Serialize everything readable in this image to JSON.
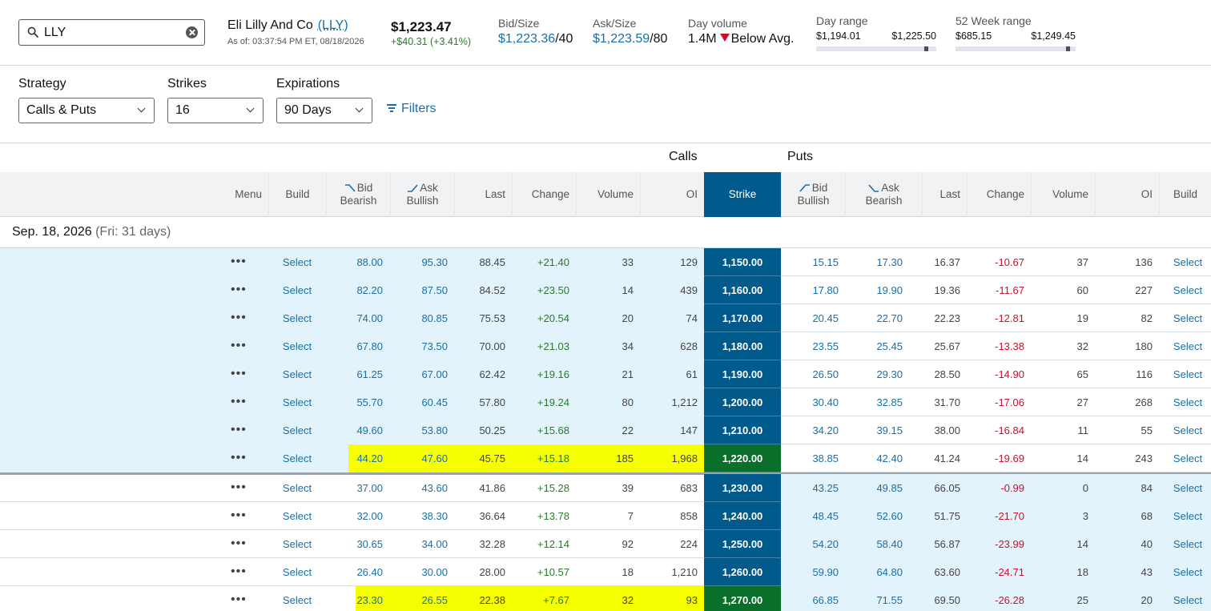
{
  "quote": {
    "search_value": "LLY",
    "company_name": "Eli Lilly And Co",
    "symbol": "(LLY)",
    "as_of": "As of: 03:37:54 PM ET, 08/18/2026",
    "last_price": "$1,223.47",
    "net_change": "+$40.31 (+3.41%)",
    "bid_size_label": "Bid/Size",
    "bid_price": "$1,223.36",
    "bid_size": "/40",
    "ask_size_label": "Ask/Size",
    "ask_price": "$1,223.59",
    "ask_size": "/80",
    "day_volume_label": "Day volume",
    "day_volume": "1.4M",
    "day_volume_note": "Below Avg.",
    "day_range_label": "Day range",
    "day_range_low": "$1,194.01",
    "day_range_high": "$1,225.50",
    "day_range_position": 0.93,
    "week52_label": "52 Week range",
    "week52_low": "$685.15",
    "week52_high": "$1,249.45",
    "week52_position": 0.95
  },
  "controls": {
    "strategy_label": "Strategy",
    "strategy_value": "Calls & Puts",
    "strikes_label": "Strikes",
    "strikes_value": "16",
    "expirations_label": "Expirations",
    "expirations_value": "90 Days",
    "filters_label": "Filters"
  },
  "chain": {
    "calls_label": "Calls",
    "puts_label": "Puts",
    "headers": {
      "menu": "Menu",
      "build": "Build",
      "bid_top": "Bid",
      "bid_bottom": "Bearish",
      "ask_top": "Ask",
      "ask_bottom": "Bullish",
      "last": "Last",
      "change": "Change",
      "volume": "Volume",
      "oi": "OI",
      "strike": "Strike",
      "put_bid_top": "Bid",
      "put_bid_bottom": "Bullish",
      "put_ask_top": "Ask",
      "put_ask_bottom": "Bearish",
      "put_last": "Last",
      "put_change": "Change",
      "put_volume": "Volume",
      "put_oi": "OI",
      "put_build": "Build"
    },
    "expiration": "Sep. 18, 2026",
    "expiration_sub": "(Fri: 31 days)",
    "select_label": "Select",
    "menu_label": "•••",
    "rows": [
      {
        "strike": "1,150.00",
        "c_bid": "88.00",
        "c_ask": "95.30",
        "c_last": "88.45",
        "c_chg": "+21.40",
        "c_vol": "33",
        "c_oi": "129",
        "p_bid": "15.15",
        "p_ask": "17.30",
        "p_last": "16.37",
        "p_chg": "-10.67",
        "p_vol": "37",
        "p_oi": "136",
        "call_itm": true,
        "put_itm": false,
        "highlight": false
      },
      {
        "strike": "1,160.00",
        "c_bid": "82.20",
        "c_ask": "87.50",
        "c_last": "84.52",
        "c_chg": "+23.50",
        "c_vol": "14",
        "c_oi": "439",
        "p_bid": "17.80",
        "p_ask": "19.90",
        "p_last": "19.36",
        "p_chg": "-11.67",
        "p_vol": "60",
        "p_oi": "227",
        "call_itm": true,
        "put_itm": false,
        "highlight": false
      },
      {
        "strike": "1,170.00",
        "c_bid": "74.00",
        "c_ask": "80.85",
        "c_last": "75.53",
        "c_chg": "+20.54",
        "c_vol": "20",
        "c_oi": "74",
        "p_bid": "20.45",
        "p_ask": "22.70",
        "p_last": "22.23",
        "p_chg": "-12.81",
        "p_vol": "19",
        "p_oi": "82",
        "call_itm": true,
        "put_itm": false,
        "highlight": false
      },
      {
        "strike": "1,180.00",
        "c_bid": "67.80",
        "c_ask": "73.50",
        "c_last": "70.00",
        "c_chg": "+21.03",
        "c_vol": "34",
        "c_oi": "628",
        "p_bid": "23.55",
        "p_ask": "25.45",
        "p_last": "25.67",
        "p_chg": "-13.38",
        "p_vol": "32",
        "p_oi": "180",
        "call_itm": true,
        "put_itm": false,
        "highlight": false
      },
      {
        "strike": "1,190.00",
        "c_bid": "61.25",
        "c_ask": "67.00",
        "c_last": "62.42",
        "c_chg": "+19.16",
        "c_vol": "21",
        "c_oi": "61",
        "p_bid": "26.50",
        "p_ask": "29.30",
        "p_last": "28.50",
        "p_chg": "-14.90",
        "p_vol": "65",
        "p_oi": "116",
        "call_itm": true,
        "put_itm": false,
        "highlight": false
      },
      {
        "strike": "1,200.00",
        "c_bid": "55.70",
        "c_ask": "60.45",
        "c_last": "57.80",
        "c_chg": "+19.24",
        "c_vol": "80",
        "c_oi": "1,212",
        "p_bid": "30.40",
        "p_ask": "32.85",
        "p_last": "31.70",
        "p_chg": "-17.06",
        "p_vol": "27",
        "p_oi": "268",
        "call_itm": true,
        "put_itm": false,
        "highlight": false
      },
      {
        "strike": "1,210.00",
        "c_bid": "49.60",
        "c_ask": "53.80",
        "c_last": "50.25",
        "c_chg": "+15.68",
        "c_vol": "22",
        "c_oi": "147",
        "p_bid": "34.20",
        "p_ask": "39.15",
        "p_last": "38.00",
        "p_chg": "-16.84",
        "p_vol": "11",
        "p_oi": "55",
        "call_itm": true,
        "put_itm": false,
        "highlight": false
      },
      {
        "strike": "1,220.00",
        "c_bid": "44.20",
        "c_ask": "47.60",
        "c_last": "45.75",
        "c_chg": "+15.18",
        "c_vol": "185",
        "c_oi": "1,968",
        "p_bid": "38.85",
        "p_ask": "42.40",
        "p_last": "41.24",
        "p_chg": "-19.69",
        "p_vol": "14",
        "p_oi": "243",
        "call_itm": true,
        "put_itm": false,
        "highlight": true
      },
      {
        "strike": "1,230.00",
        "c_bid": "37.00",
        "c_ask": "43.60",
        "c_last": "41.86",
        "c_chg": "+15.28",
        "c_vol": "39",
        "c_oi": "683",
        "p_bid": "43.25",
        "p_ask": "49.85",
        "p_last": "66.05",
        "p_chg": "-0.99",
        "p_vol": "0",
        "p_oi": "84",
        "call_itm": false,
        "put_itm": true,
        "highlight": false
      },
      {
        "strike": "1,240.00",
        "c_bid": "32.00",
        "c_ask": "38.30",
        "c_last": "36.64",
        "c_chg": "+13.78",
        "c_vol": "7",
        "c_oi": "858",
        "p_bid": "48.45",
        "p_ask": "52.60",
        "p_last": "51.75",
        "p_chg": "-21.70",
        "p_vol": "3",
        "p_oi": "68",
        "call_itm": false,
        "put_itm": true,
        "highlight": false
      },
      {
        "strike": "1,250.00",
        "c_bid": "30.65",
        "c_ask": "34.00",
        "c_last": "32.28",
        "c_chg": "+12.14",
        "c_vol": "92",
        "c_oi": "224",
        "p_bid": "54.20",
        "p_ask": "58.40",
        "p_last": "56.87",
        "p_chg": "-23.99",
        "p_vol": "14",
        "p_oi": "40",
        "call_itm": false,
        "put_itm": true,
        "highlight": false
      },
      {
        "strike": "1,260.00",
        "c_bid": "26.40",
        "c_ask": "30.00",
        "c_last": "28.00",
        "c_chg": "+10.57",
        "c_vol": "18",
        "c_oi": "1,210",
        "p_bid": "59.90",
        "p_ask": "64.80",
        "p_last": "63.60",
        "p_chg": "-24.71",
        "p_vol": "18",
        "p_oi": "43",
        "call_itm": false,
        "put_itm": true,
        "highlight": false
      },
      {
        "strike": "1,270.00",
        "c_bid": "23.30",
        "c_ask": "26.55",
        "c_last": "22.38",
        "c_chg": "+7.67",
        "c_vol": "32",
        "c_oi": "93",
        "p_bid": "66.85",
        "p_ask": "71.55",
        "p_last": "69.50",
        "p_chg": "-26.28",
        "p_vol": "25",
        "p_oi": "20",
        "call_itm": false,
        "put_itm": true,
        "highlight": true
      }
    ]
  },
  "colors": {
    "strike_bg": "#005a8c",
    "strike_highlight_bg": "#0a6f2b",
    "itm_bg": "#e3f3fb",
    "highlight_bg": "#f6ff00",
    "positive": "#2b7a2b",
    "negative": "#c8102e",
    "link": "#1a6fa3"
  },
  "icons": {
    "search": "search-icon",
    "clear": "clear-icon",
    "filter": "filter-icon",
    "menu": "more-horizontal-icon",
    "down_triangle": "down-triangle-icon",
    "chevron": "chevron-down-icon"
  }
}
